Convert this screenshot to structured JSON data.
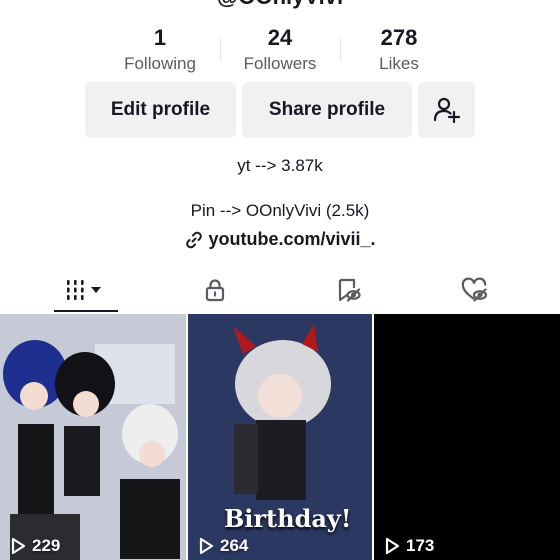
{
  "profile": {
    "username_partial": "@OOnlyVivi",
    "stats": {
      "following": {
        "value": "1",
        "label": "Following"
      },
      "followers": {
        "value": "24",
        "label": "Followers"
      },
      "likes": {
        "value": "278",
        "label": "Likes"
      }
    },
    "buttons": {
      "edit": "Edit profile",
      "share": "Share profile",
      "add_friend_icon": "add-person-icon"
    },
    "bio": {
      "line1": "yt --> 3.87k",
      "line2": "Pin --> OOnlyVivi (2.5k)",
      "link": "youtube.com/vivii_."
    }
  },
  "tabs": [
    {
      "name": "videos",
      "icon": "grid-icon",
      "active": true
    },
    {
      "name": "private",
      "icon": "lock-icon",
      "active": false
    },
    {
      "name": "favorites",
      "icon": "bookmark-hidden-icon",
      "active": false
    },
    {
      "name": "liked",
      "icon": "heart-hidden-icon",
      "active": false
    }
  ],
  "videos": [
    {
      "views": "229",
      "overlay_text": ""
    },
    {
      "views": "264",
      "overlay_text": "Birthday!"
    },
    {
      "views": "173",
      "overlay_text": ""
    }
  ],
  "colors": {
    "text": "#161823",
    "secondary": "#5a5b63",
    "button_bg": "#f1f1f2"
  }
}
